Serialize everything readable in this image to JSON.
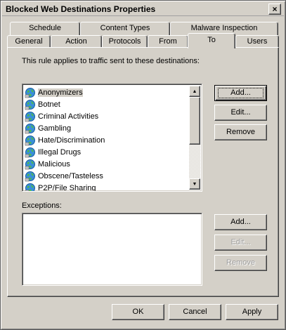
{
  "window": {
    "title": "Blocked Web Destinations Properties",
    "close_glyph": "×"
  },
  "tabs_back_row": [
    "Schedule",
    "Content Types",
    "Malware Inspection"
  ],
  "tabs_front_row": [
    "General",
    "Action",
    "Protocols",
    "From",
    "To",
    "Users"
  ],
  "active_tab": "To",
  "panel": {
    "intro_text": "This rule applies to traffic sent to these destinations:",
    "destinations": [
      "Anonymizers",
      "Botnet",
      "Criminal Activities",
      "Gambling",
      "Hate/Discrimination",
      "Illegal Drugs",
      "Malicious",
      "Obscene/Tasteless",
      "P2P/File Sharing"
    ],
    "selected_destination": "Anonymizers",
    "dest_buttons": {
      "add": "Add...",
      "edit": "Edit...",
      "remove": "Remove"
    },
    "exceptions_label": "Exceptions:",
    "exceptions": [],
    "exc_buttons": {
      "add": "Add...",
      "edit": "Edit...",
      "remove": "Remove"
    }
  },
  "footer": {
    "ok": "OK",
    "cancel": "Cancel",
    "apply": "Apply"
  },
  "icons": {
    "list_item_icon": "network-globe-icon",
    "scroll_up": "scroll-up-arrow-icon",
    "scroll_down": "scroll-down-arrow-icon"
  }
}
